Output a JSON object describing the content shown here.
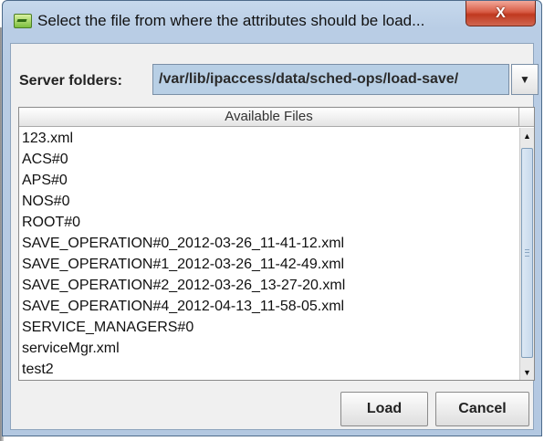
{
  "window": {
    "title": "Select the file from where the attributes should be load...",
    "close_glyph": "X"
  },
  "folder": {
    "label": "Server folders:",
    "selected": "/var/lib/ipaccess/data/sched-ops/load-save/",
    "arrow_icon": "chevron-down-icon"
  },
  "table": {
    "header": "Available Files",
    "rows": [
      "123.xml",
      "ACS#0",
      "APS#0",
      "NOS#0",
      "ROOT#0",
      "SAVE_OPERATION#0_2012-03-26_11-41-12.xml",
      "SAVE_OPERATION#1_2012-03-26_11-42-49.xml",
      "SAVE_OPERATION#2_2012-03-26_13-27-20.xml",
      "SAVE_OPERATION#4_2012-04-13_11-58-05.xml",
      "SERVICE_MANAGERS#0",
      "serviceMgr.xml",
      "test2"
    ]
  },
  "buttons": {
    "load": "Load",
    "cancel": "Cancel"
  }
}
